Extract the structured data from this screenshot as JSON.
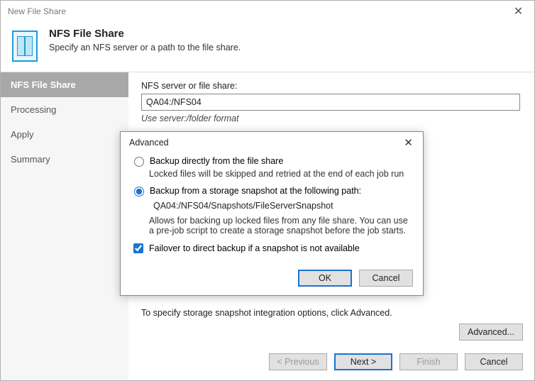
{
  "window": {
    "title": "New File Share",
    "close_glyph": "✕"
  },
  "header": {
    "title": "NFS File Share",
    "subtitle": "Specify an NFS server or a path to the file share."
  },
  "sidebar": {
    "steps": [
      {
        "label": "NFS File Share",
        "active": true
      },
      {
        "label": "Processing",
        "active": false
      },
      {
        "label": "Apply",
        "active": false
      },
      {
        "label": "Summary",
        "active": false
      }
    ]
  },
  "main": {
    "field_label": "NFS server or file share:",
    "field_value": "QA04:/NFS04",
    "hint": "Use server:/folder format",
    "footer_hint": "To specify storage snapshot integration options, click Advanced.",
    "advanced_button": "Advanced..."
  },
  "wizard_buttons": {
    "previous": "< Previous",
    "next": "Next >",
    "finish": "Finish",
    "cancel": "Cancel"
  },
  "modal": {
    "title": "Advanced",
    "close_glyph": "✕",
    "option_direct": {
      "label": "Backup directly from the file share",
      "desc": "Locked files will be skipped and retried at the end of each job run",
      "checked": false
    },
    "option_snapshot": {
      "label": "Backup from a storage snapshot at the following path:",
      "path": "QA04:/NFS04/Snapshots/FileServerSnapshot",
      "desc": "Allows for backing up locked files from any file share. You can use a pre-job script to create a storage snapshot before the job starts.",
      "checked": true
    },
    "failover": {
      "label": "Failover to direct backup if a snapshot is not available",
      "checked": true
    },
    "buttons": {
      "ok": "OK",
      "cancel": "Cancel"
    }
  }
}
